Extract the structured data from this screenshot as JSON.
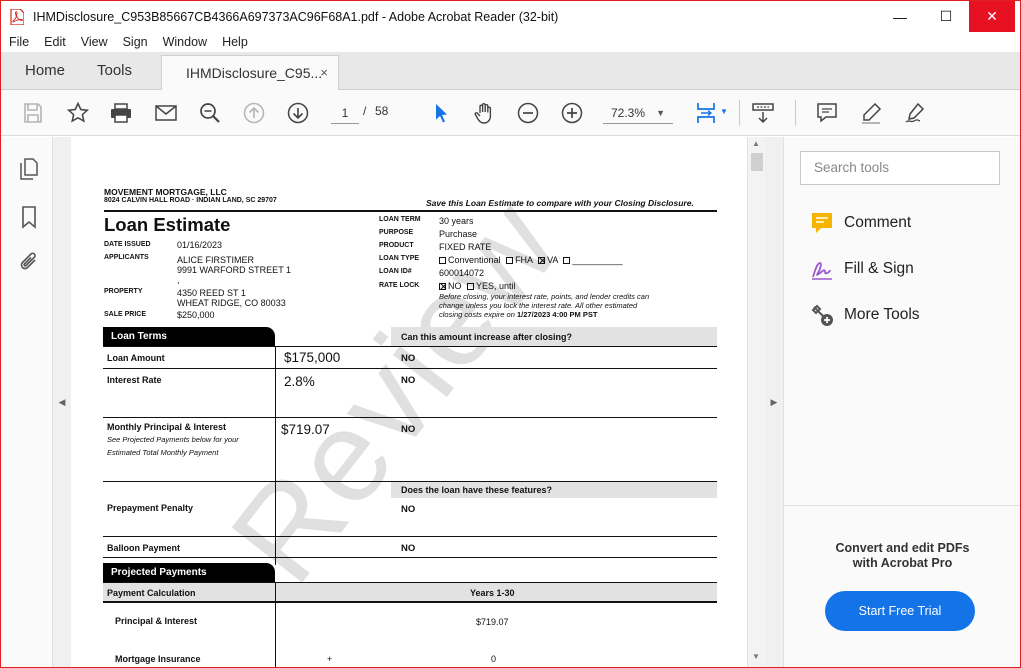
{
  "window": {
    "title": "IHMDisclosure_C953B85667CB4366A697373AC96F68A1.pdf - Adobe Acrobat Reader (32-bit)",
    "controls": {
      "minimize": "—",
      "maximize": "☐",
      "close": "✕"
    }
  },
  "menu": [
    "File",
    "Edit",
    "View",
    "Sign",
    "Window",
    "Help"
  ],
  "tabs": {
    "home": "Home",
    "tools": "Tools",
    "document": "IHMDisclosure_C95...",
    "close": "×"
  },
  "toolbar": {
    "current_page": "1",
    "page_separator": "/",
    "total_pages": "58",
    "zoom": "72.3%"
  },
  "right_pane": {
    "search_placeholder": "Search tools",
    "tools": [
      {
        "label": "Comment",
        "icon": "comment-icon",
        "color": "#f4b400"
      },
      {
        "label": "Fill & Sign",
        "icon": "fill-sign-icon",
        "color": "#9b59d0"
      },
      {
        "label": "More Tools",
        "icon": "more-tools-icon",
        "color": "#555555"
      }
    ],
    "promo_line1": "Convert and edit PDFs",
    "promo_line2": "with Acrobat Pro",
    "trial_button": "Start Free Trial",
    "accent": "#1473e6"
  },
  "document": {
    "lender_name": "MOVEMENT MORTGAGE, LLC",
    "lender_address": "8024 CALVIN HALL ROAD · INDIAN LAND, SC 29707",
    "save_note": "Save this Loan Estimate to compare with your Closing Disclosure.",
    "title": "Loan Estimate",
    "left_fields": {
      "date_issued_label": "DATE ISSUED",
      "date_issued": "01/16/2023",
      "applicants_label": "APPLICANTS",
      "applicant_name": "ALICE FIRSTIMER",
      "applicant_street": "9991 WARFORD STREET 1",
      "applicant_extra": ",",
      "property_label": "PROPERTY",
      "property_street": "4350 REED ST 1",
      "property_city": "WHEAT RIDGE, CO 80033",
      "sale_price_label": "SALE PRICE",
      "sale_price": "$250,000"
    },
    "right_fields": {
      "loan_term_label": "LOAN TERM",
      "loan_term": "30 years",
      "purpose_label": "PURPOSE",
      "purpose": "Purchase",
      "product_label": "PRODUCT",
      "product": "FIXED RATE",
      "loan_type_label": "LOAN TYPE",
      "loan_type_conventional": "Conventional",
      "loan_type_fha": "FHA",
      "loan_type_va": "VA",
      "loan_type_other": "__________",
      "loan_id_label": "LOAN ID#",
      "loan_id": "600014072",
      "rate_lock_label": "RATE LOCK",
      "rate_lock_no": "NO",
      "rate_lock_yes": "YES, until",
      "rate_lock_note1": "Before closing, your interest rate, points, and lender credits can",
      "rate_lock_note2": "change unless you lock the interest rate. All other estimated",
      "rate_lock_note3_prefix": "closing costs expire on",
      "rate_lock_note3_date": "1/27/2023 4:00 PM PST"
    },
    "loan_terms": {
      "section": "Loan Terms",
      "question1": "Can this amount increase after closing?",
      "question2": "Does the loan have these features?",
      "rows": [
        {
          "label": "Loan Amount",
          "sub1": "",
          "sub2": "",
          "amount": "$175,000",
          "answer": "NO"
        },
        {
          "label": "Interest Rate",
          "sub1": "",
          "sub2": "",
          "amount": "2.8%",
          "answer": "NO"
        },
        {
          "label": "Monthly Principal & Interest",
          "sub1": "See Projected Payments below for your",
          "sub2": "Estimated Total Monthly Payment",
          "amount": "$719.07",
          "answer": "NO"
        },
        {
          "label": "Prepayment Penalty",
          "sub1": "",
          "sub2": "",
          "amount": "",
          "answer": "NO"
        },
        {
          "label": "Balloon Payment",
          "sub1": "",
          "sub2": "",
          "amount": "",
          "answer": "NO"
        }
      ]
    },
    "projected": {
      "section": "Projected Payments",
      "calc_label": "Payment Calculation",
      "years": "Years 1-30",
      "pi_label": "Principal & Interest",
      "pi_value": "$719.07",
      "mi_label": "Mortgage Insurance",
      "mi_plus": "+",
      "mi_value": "0"
    },
    "watermark": "Review"
  }
}
